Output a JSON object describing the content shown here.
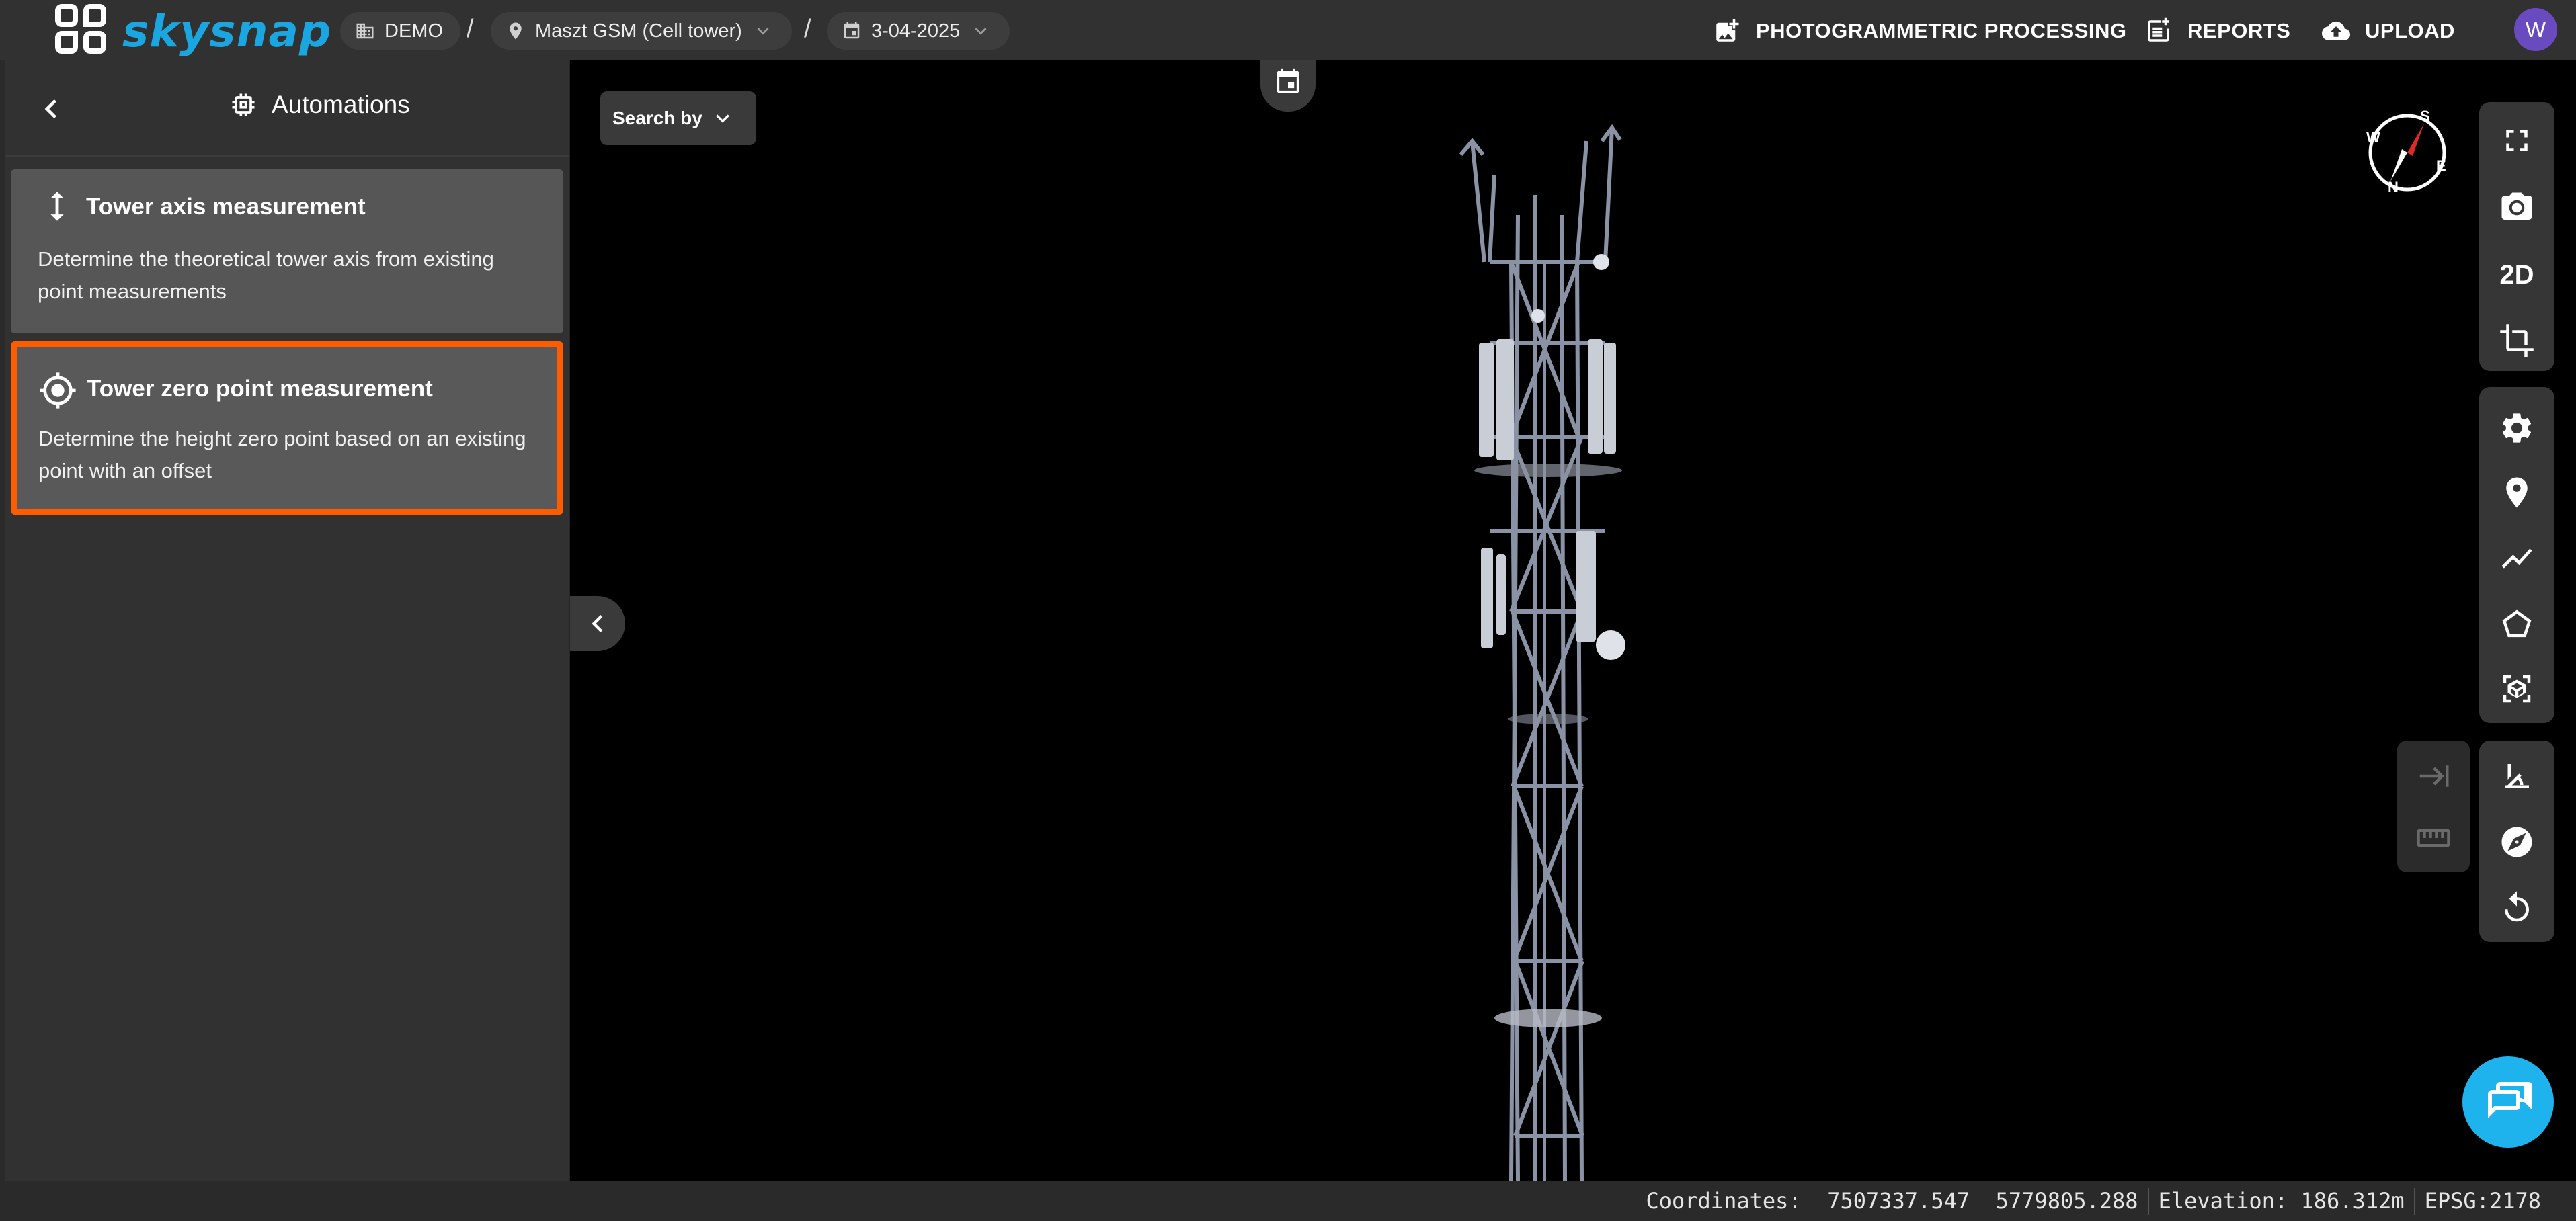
{
  "app": {
    "brand": "skysnap",
    "avatar_initial": "W"
  },
  "breadcrumb": {
    "organization": "DEMO",
    "project": "Maszt GSM (Cell tower)",
    "date": "3-04-2025",
    "separator": "/"
  },
  "top_actions": {
    "processing": "PHOTOGRAMMETRIC PROCESSING",
    "reports": "REPORTS",
    "upload": "UPLOAD"
  },
  "sidebar": {
    "title": "Automations",
    "cards": [
      {
        "title": "Tower axis measurement",
        "description": "Determine the theoretical tower axis from existing point measurements",
        "icon": "vertical-arrows-icon",
        "selected": false
      },
      {
        "title": "Tower zero point measurement",
        "description": "Determine the height zero point based on an existing point with an offset",
        "icon": "crosshair-icon",
        "selected": true
      }
    ]
  },
  "viewer": {
    "search_label": "Search by",
    "mode_2d": "2D",
    "compass_letters": [
      "N",
      "S",
      "E",
      "W"
    ]
  },
  "statusbar": {
    "coordinates_label": "Coordinates:",
    "x": "7507337.547",
    "y": "5779805.288",
    "elevation_label": "Elevation:",
    "elevation": "186.312m",
    "epsg": "EPSG:2178"
  },
  "colors": {
    "accent": "#1aa6e0",
    "selection": "#ff5c00",
    "chat": "#1fb3ee",
    "avatar": "#6a4bbf"
  }
}
